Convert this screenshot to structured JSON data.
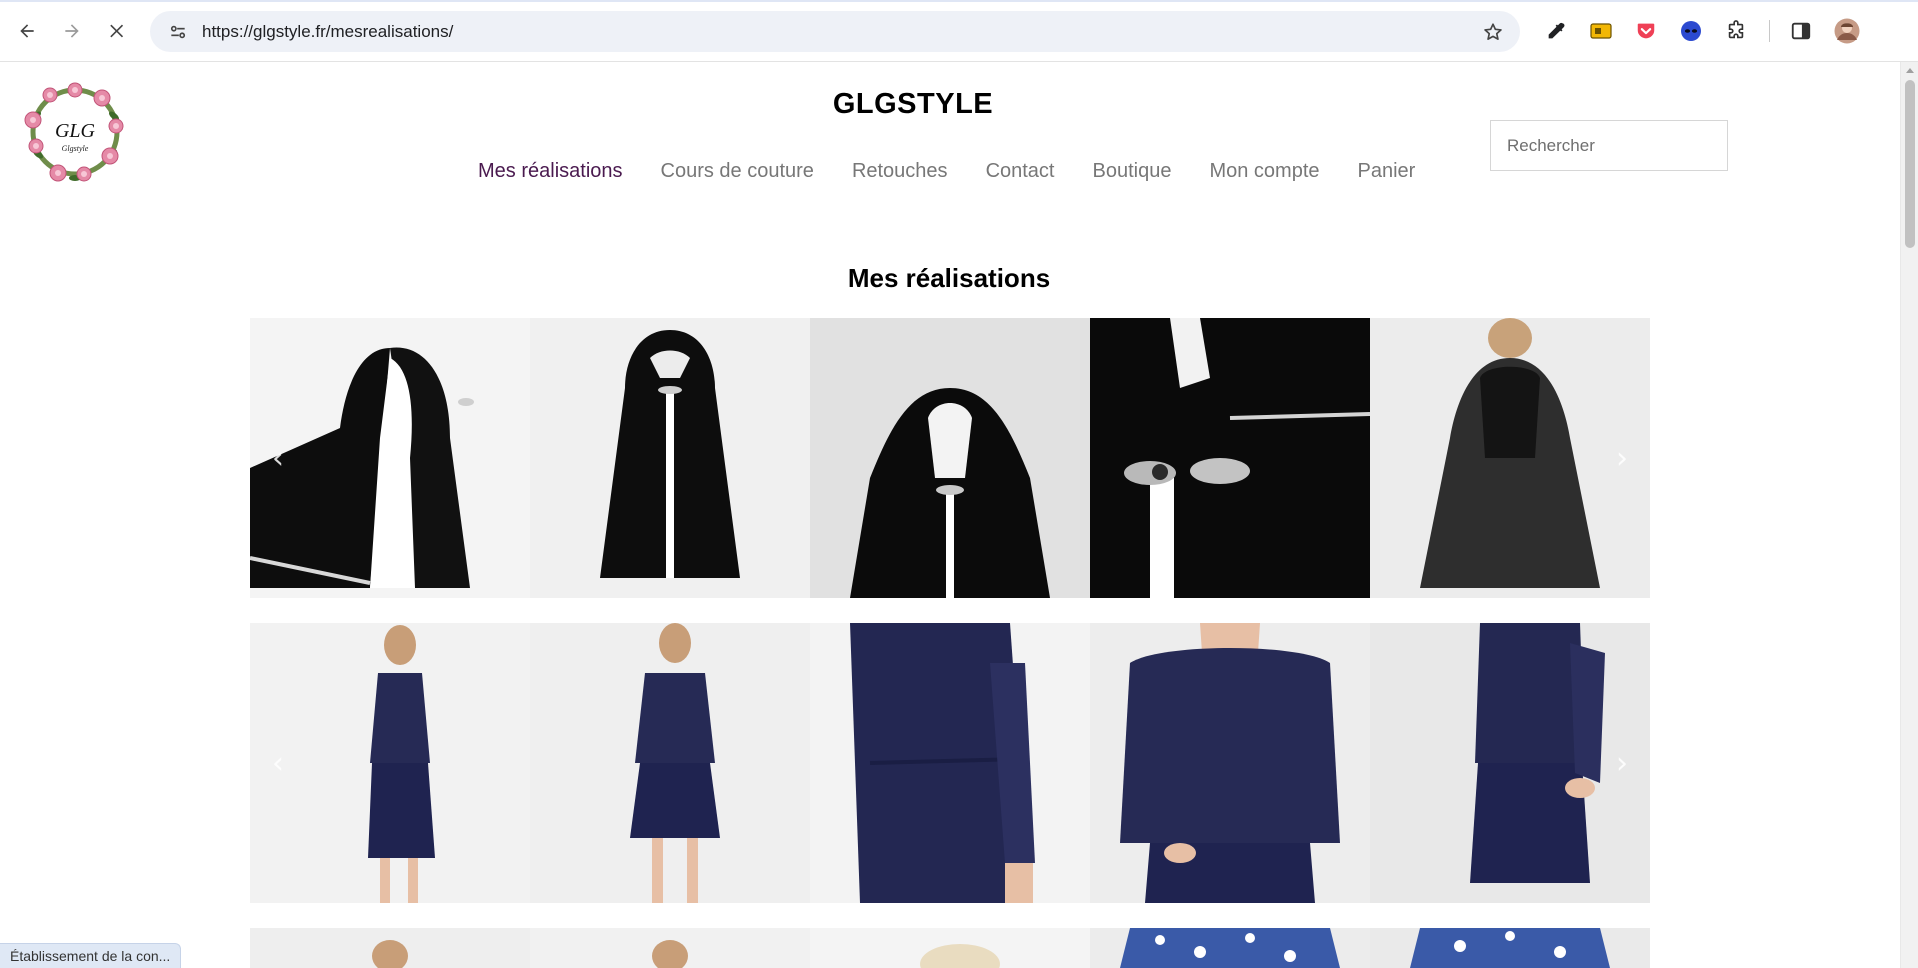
{
  "browser": {
    "url": "https://glgstyle.fr/mesrealisations/",
    "status_text": "Établissement de la con..."
  },
  "site": {
    "title": "GLGSTYLE",
    "logo_text": "GLG",
    "logo_subtext": "Glgstyle"
  },
  "nav": {
    "items": [
      {
        "label": "Mes réalisations",
        "active": true
      },
      {
        "label": "Cours de couture",
        "active": false
      },
      {
        "label": "Retouches",
        "active": false
      },
      {
        "label": "Contact",
        "active": false
      },
      {
        "label": "Boutique",
        "active": false
      },
      {
        "label": "Mon compte",
        "active": false
      },
      {
        "label": "Panier",
        "active": false
      }
    ]
  },
  "search": {
    "placeholder": "Rechercher"
  },
  "page": {
    "heading": "Mes réalisations"
  },
  "galleries": [
    {
      "name": "black-hooded-cape",
      "arrow_left": "‹",
      "arrow_right": "›",
      "colors": {
        "garment": "#0d0d0d",
        "bg": "#e6e6e6",
        "trim": "#d8d8d8"
      }
    },
    {
      "name": "navy-dress-ensemble",
      "arrow_left": "‹",
      "arrow_right": "›",
      "colors": {
        "garment": "#262a55",
        "bg": "#eeeeee",
        "skin": "#e7bfa5"
      }
    },
    {
      "name": "floral-blue-print",
      "colors": {
        "print": "#3a5aa8",
        "bg": "#ececec"
      }
    }
  ]
}
